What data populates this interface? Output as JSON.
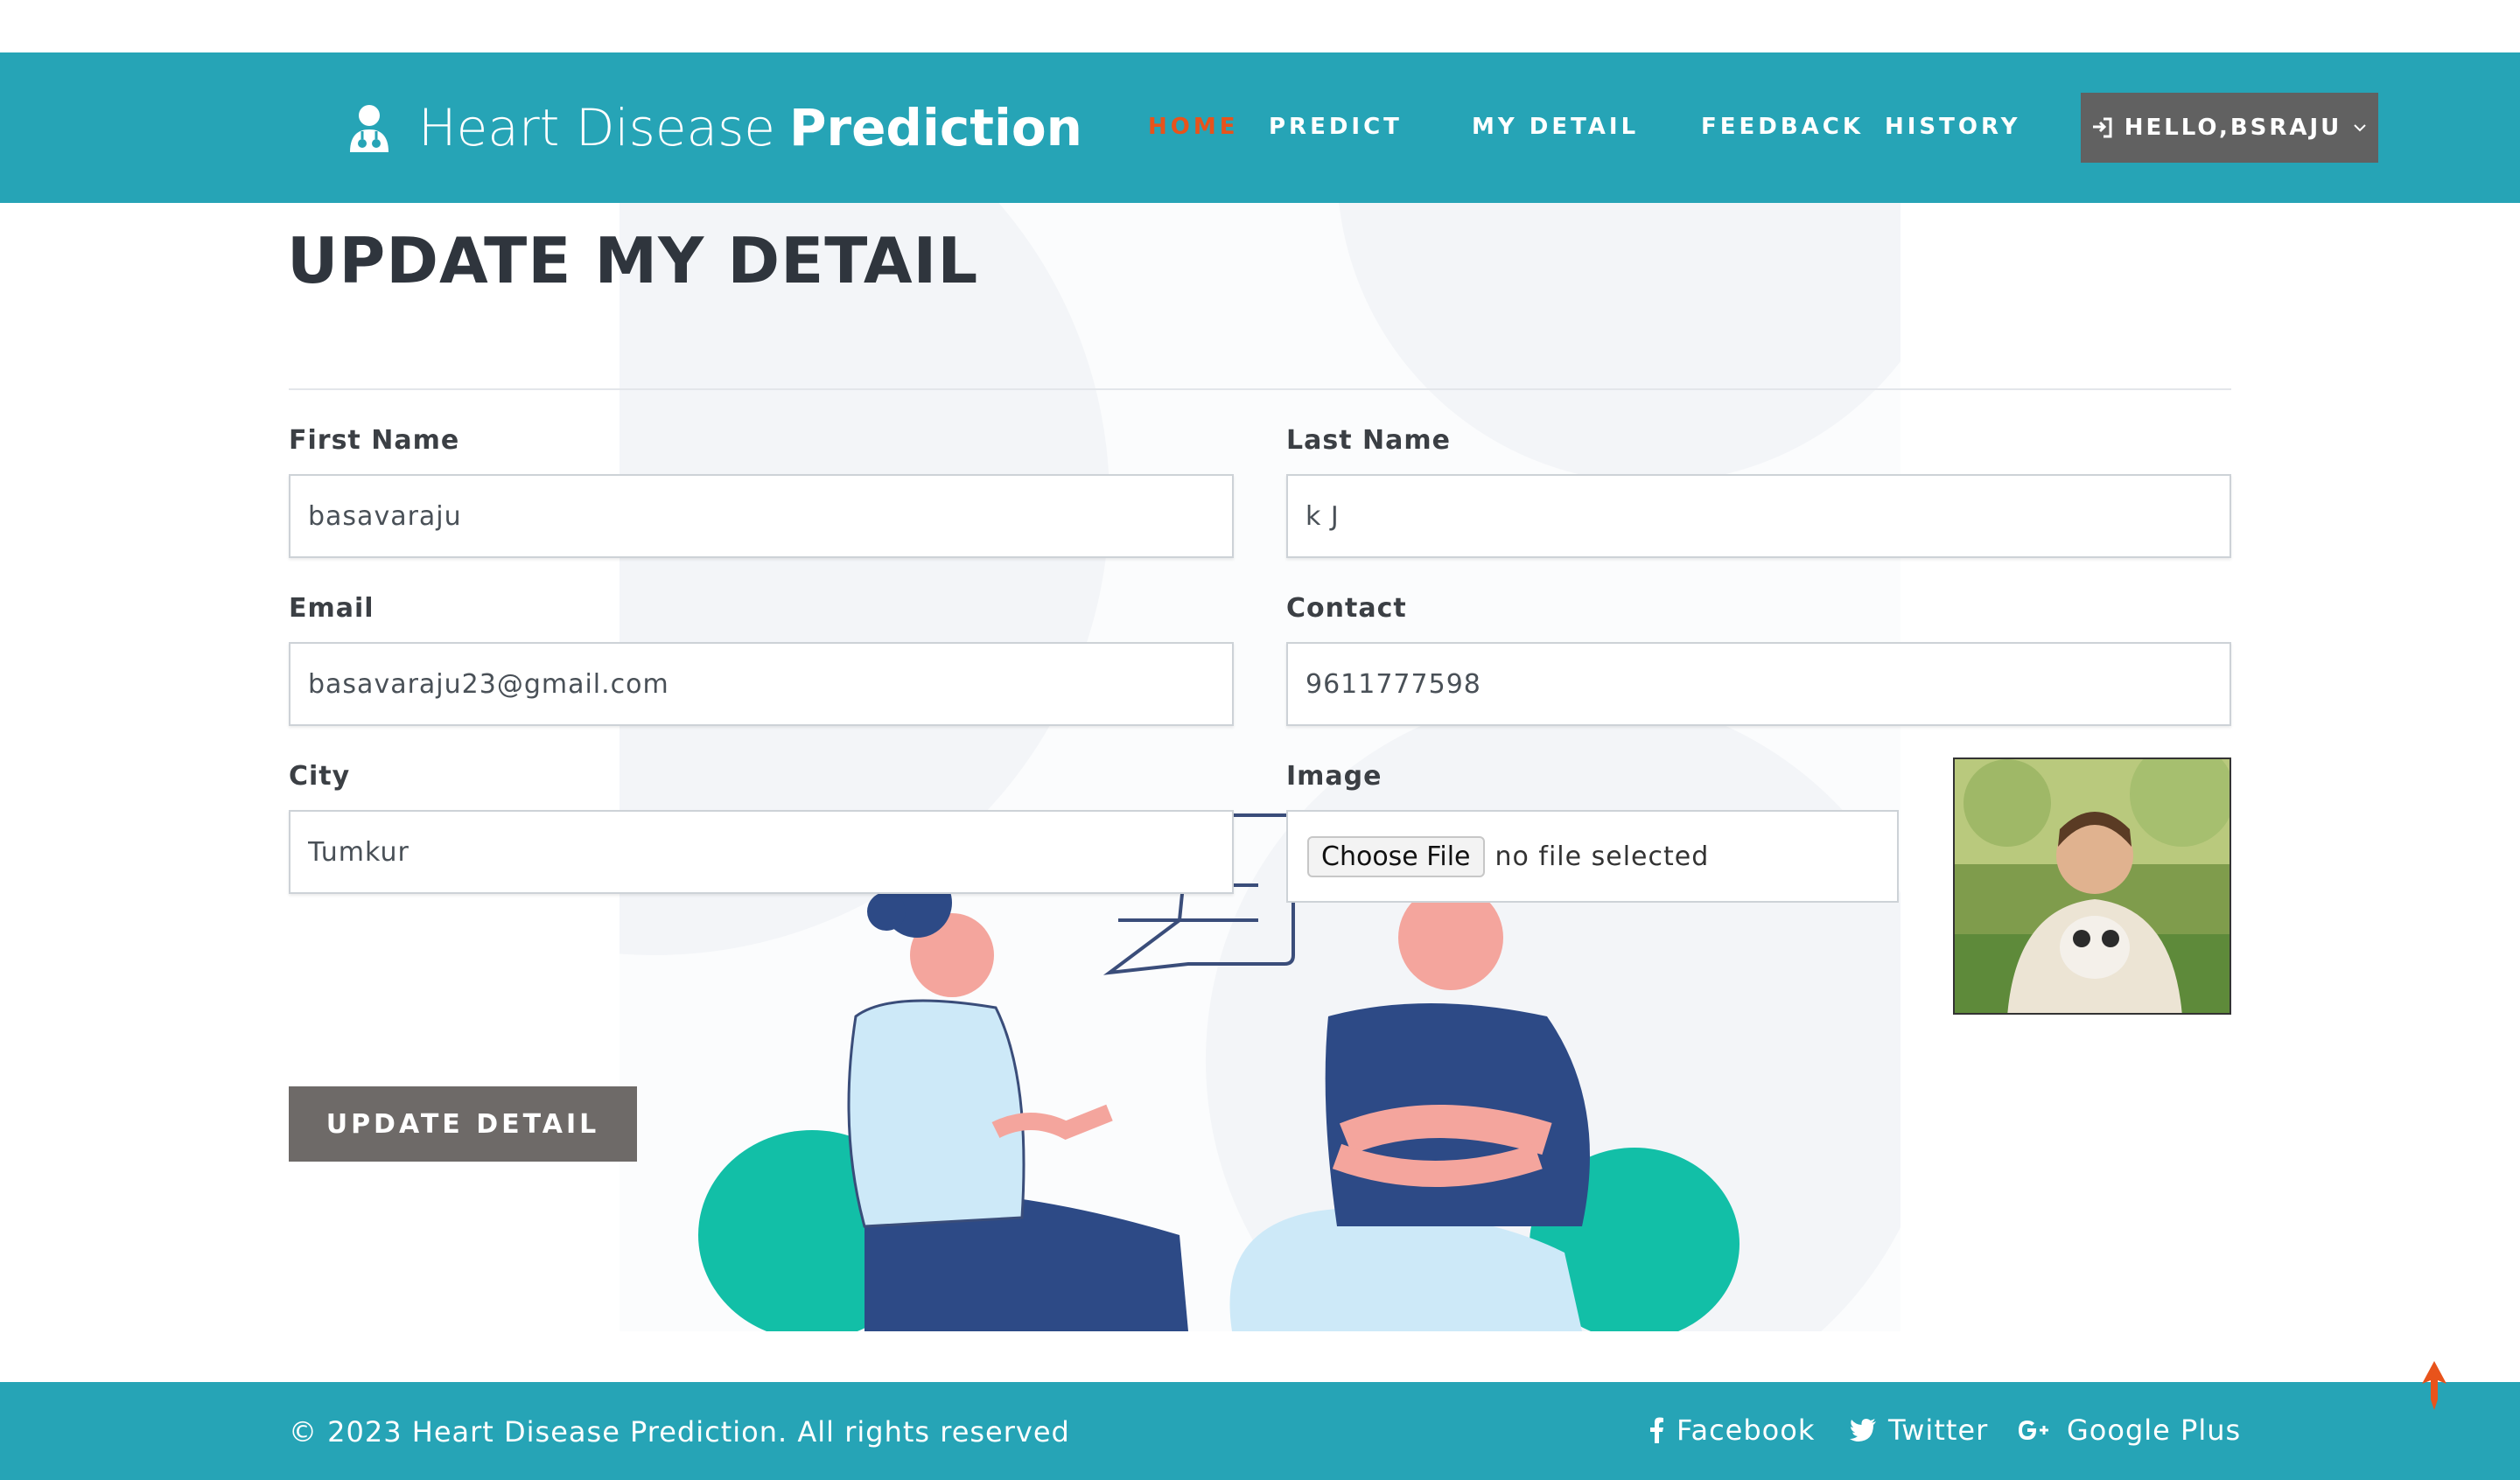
{
  "header": {
    "brand_light": "Heart Disease",
    "brand_bold": "Prediction",
    "brand_icon": "doctor-icon",
    "nav": {
      "home": "HOME",
      "predict": "PREDICT",
      "my_detail": "MY DETAIL",
      "feedback": "FEEDBACK",
      "history": "HISTORY"
    },
    "user_menu_label": "HELLO,BSRAJU"
  },
  "main": {
    "title": "UPDATE MY DETAIL",
    "form": {
      "first_name_label": "First Name",
      "first_name_value": "basavaraju",
      "last_name_label": "Last Name",
      "last_name_value": "k J",
      "email_label": "Email",
      "email_value": "basavaraju23@gmail.com",
      "contact_label": "Contact",
      "contact_value": "9611777598",
      "city_label": "City",
      "city_value": "Tumkur",
      "image_label": "Image",
      "choose_file_label": "Choose File",
      "file_status": "no file selected",
      "submit_label": "UPDATE DETAIL"
    }
  },
  "footer": {
    "copyright": "© 2023 Heart Disease Prediction. All rights reserved",
    "facebook": "Facebook",
    "twitter": "Twitter",
    "google_plus": "Google Plus"
  },
  "colors": {
    "header_bg": "#26a4b6",
    "nav_active": "#e8531b",
    "button_bg": "#6e6a68",
    "user_button_bg": "#616161"
  }
}
